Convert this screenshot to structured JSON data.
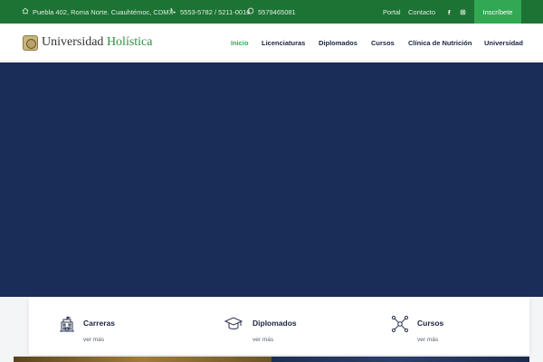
{
  "topbar": {
    "address": "Puebla 402, Roma Norte. Cuauhtémoc, CDMX",
    "phones": "5553-5782 / 5211-0016",
    "whatsapp": "5579465081",
    "links": [
      "Portal",
      "Contacto"
    ],
    "social": [
      "facebook-icon",
      "instagram-icon"
    ],
    "cta_label": "Inscríbete"
  },
  "header": {
    "logo_text_primary": "Universidad",
    "logo_text_accent": "Holística",
    "nav": [
      {
        "label": "Inicio",
        "active": true
      },
      {
        "label": "Licenciaturas",
        "active": false
      },
      {
        "label": "Diplomados",
        "active": false
      },
      {
        "label": "Cursos",
        "active": false
      },
      {
        "label": "Clínica de Nutrición",
        "active": false
      },
      {
        "label": "Universidad",
        "active": false
      }
    ]
  },
  "features": [
    {
      "title": "Carreras",
      "link": "ver más",
      "icon": "building-icon"
    },
    {
      "title": "Diplomados",
      "link": "ver más",
      "icon": "graduation-cap-icon"
    },
    {
      "title": "Cursos",
      "link": "ver más",
      "icon": "network-icon"
    }
  ],
  "colors": {
    "topbar": "#1d7333",
    "cta": "#33a852",
    "hero": "#1a2d59",
    "nav_active": "#33a852",
    "nav_text": "#1a2340"
  }
}
